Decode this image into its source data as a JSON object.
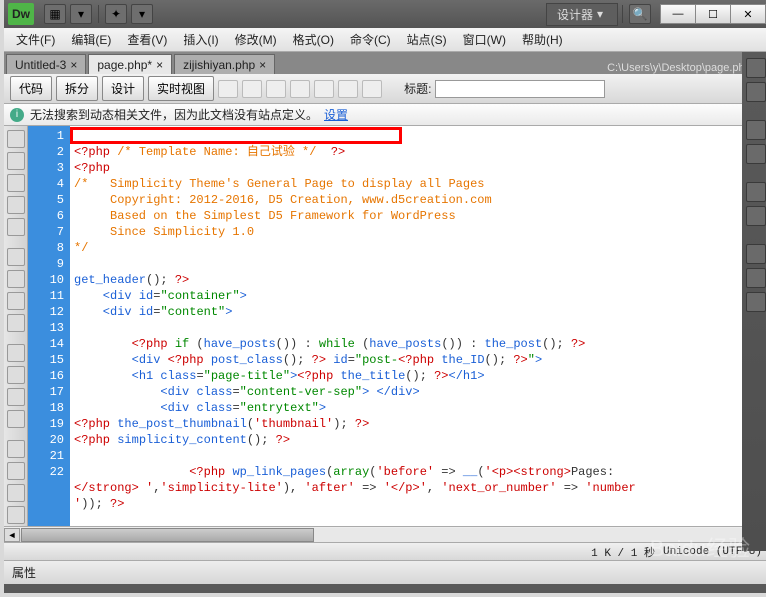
{
  "app": {
    "logo": "Dw",
    "workspace": "设计器"
  },
  "menu": [
    "文件(F)",
    "编辑(E)",
    "查看(V)",
    "插入(I)",
    "修改(M)",
    "格式(O)",
    "命令(C)",
    "站点(S)",
    "窗口(W)",
    "帮助(H)"
  ],
  "tabs": [
    {
      "label": "Untitled-3",
      "close": "×"
    },
    {
      "label": "page.php*",
      "close": "×"
    },
    {
      "label": "zijishiyan.php",
      "close": "×"
    }
  ],
  "filepath": "C:\\Users\\y\\Desktop\\page.php",
  "views": {
    "code": "代码",
    "split": "拆分",
    "design": "设计",
    "live": "实时视图"
  },
  "title_label": "标题:",
  "warn": {
    "msg": "无法搜索到动态相关文件，因为此文档没有站点定义。",
    "link": "设置"
  },
  "lines": [
    "1",
    "2",
    "3",
    "4",
    "5",
    "6",
    "7",
    "8",
    "9",
    "10",
    "11",
    "12",
    "13",
    "14",
    "15",
    "16",
    "17",
    "18",
    "19",
    "20",
    "21",
    "",
    "22"
  ],
  "code": {
    "l1a": "<?php ",
    "l1b": "/* Template Name: 自己试验 */",
    "l1c": "  ?>",
    "l2": "<?php",
    "l3": "/*   Simplicity Theme's General Page to display all Pages",
    "l4": "     Copyright: 2012-2016, D5 Creation, www.d5creation.com",
    "l5": "     Based on the Simplest D5 Framework for WordPress",
    "l6": "     Since Simplicity 1.0",
    "l7": "*/",
    "l9a": "get_header",
    "l9b": "();",
    "l9c": " ?>",
    "l10a": "    <",
    "l10b": "div ",
    "l10c": "id",
    "l10d": "=",
    "l10e": "\"container\"",
    "l10f": ">",
    "l11a": "    <",
    "l11b": "div ",
    "l11c": "id",
    "l11d": "=",
    "l11e": "\"content\"",
    "l11f": ">",
    "l13a": "        <?php ",
    "l13b": "if",
    "l13c": " (",
    "l13d": "have_posts",
    "l13e": "()) : ",
    "l13f": "while",
    "l13g": " (",
    "l13h": "have_posts",
    "l13i": "()) : ",
    "l13j": "the_post",
    "l13k": "();",
    "l13l": " ?>",
    "l14a": "        <",
    "l14b": "div ",
    "l14c": "<?php ",
    "l14d": "post_class",
    "l14e": "();",
    "l14f": " ?>",
    "l14g": " id",
    "l14h": "=",
    "l14i": "\"post-",
    "l14j": "<?php ",
    "l14k": "the_ID",
    "l14l": "();",
    "l14m": " ?>",
    "l14n": "\"",
    "l14o": ">",
    "l15a": "        <",
    "l15b": "h1 ",
    "l15c": "class",
    "l15d": "=",
    "l15e": "\"page-title\"",
    "l15f": ">",
    "l15g": "<?php ",
    "l15h": "the_title",
    "l15i": "();",
    "l15j": " ?>",
    "l15k": "</",
    "l15l": "h1",
    "l15m": ">",
    "l16a": "            <",
    "l16b": "div ",
    "l16c": "class",
    "l16d": "=",
    "l16e": "\"content-ver-sep\"",
    "l16f": "> </",
    "l16g": "div",
    "l16h": ">",
    "l17a": "            <",
    "l17b": "div ",
    "l17c": "class",
    "l17d": "=",
    "l17e": "\"entrytext\"",
    "l17f": ">",
    "l18a": "<?php ",
    "l18b": "the_post_thumbnail",
    "l18c": "(",
    "l18d": "'thumbnail'",
    "l18e": ");",
    "l18f": " ?>",
    "l19a": "<?php ",
    "l19b": "simplicity_content",
    "l19c": "();",
    "l19d": " ?>",
    "l21a": "                <?php ",
    "l21b": "wp_link_pages",
    "l21c": "(",
    "l21d": "array",
    "l21e": "(",
    "l21f": "'before'",
    "l21g": " => ",
    "l21h": "__",
    "l21i": "(",
    "l21j": "'<p><strong>",
    "l21k": "Pages:",
    "l22a": "</strong> '",
    "l22b": ",",
    "l22c": "'simplicity-lite'",
    "l22d": "), ",
    "l22e": "'after'",
    "l22f": " => ",
    "l22g": "'</p>'",
    "l22h": ", ",
    "l22i": "'next_or_number'",
    "l22j": " => ",
    "l22k": "'number",
    "l23a": "'",
    "l23b": "));",
    "l23c": " ?>"
  },
  "status": {
    "size": "1 K / 1 秒",
    "encoding": "Unicode (UTF-8)"
  },
  "prop": "属性"
}
